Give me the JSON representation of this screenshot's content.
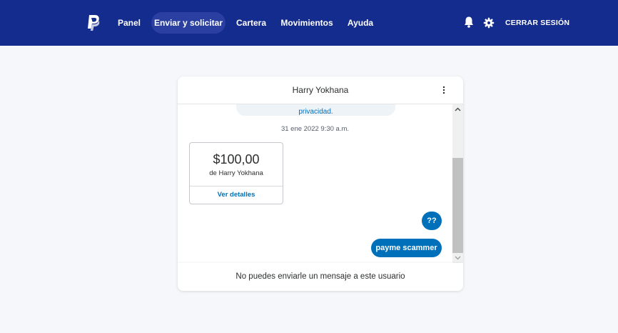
{
  "header": {
    "logo_icon": "paypal-logo",
    "nav": [
      {
        "label": "Panel"
      },
      {
        "label": "Enviar y solicitar",
        "active": true
      },
      {
        "label": "Cartera"
      },
      {
        "label": "Movimientos"
      },
      {
        "label": "Ayuda"
      }
    ],
    "notifications_icon": "bell-icon",
    "settings_icon": "gear-icon",
    "logout_label": "CERRAR SESIÓN"
  },
  "conversation": {
    "contact_name": "Harry Yokhana",
    "menu_icon": "more-vertical-icon",
    "previous_message_fragment": "privacidad.",
    "timestamp": "31 ene 2022 9:30 a.m.",
    "payment": {
      "amount": "$100,00",
      "from": "de Harry Yokhana",
      "details_link": "Ver detalles"
    },
    "messages": [
      {
        "text": "??",
        "direction": "outgoing"
      },
      {
        "text": "payme scammer",
        "direction": "outgoing"
      }
    ],
    "footer_notice": "No puedes enviarle un mensaje a este usuario"
  },
  "colors": {
    "header_bg": "#142c8e",
    "active_nav_bg": "#2a3fa0",
    "accent": "#0070ba",
    "page_bg": "#f5f7fa"
  }
}
